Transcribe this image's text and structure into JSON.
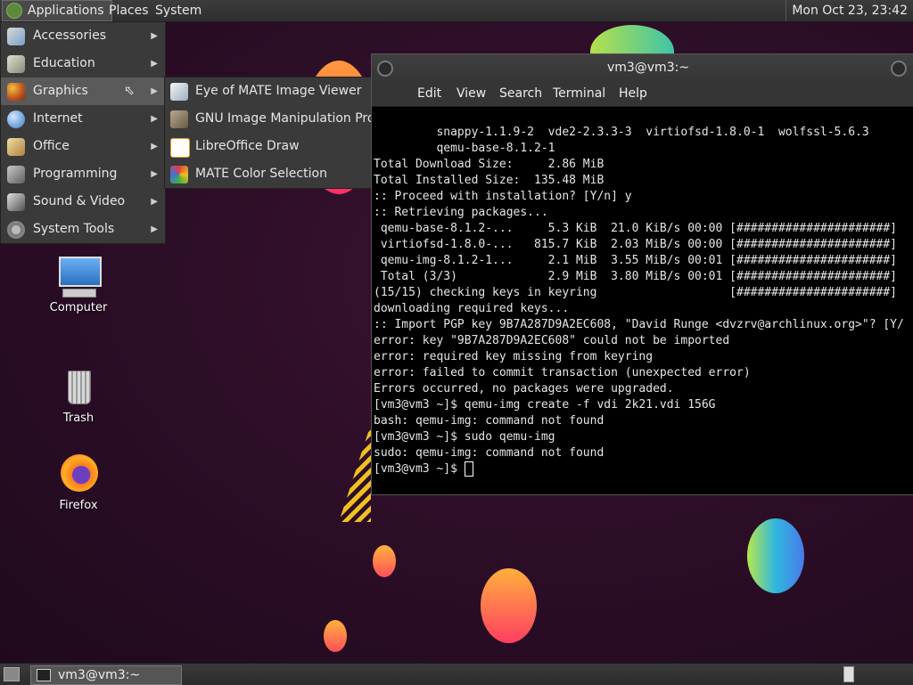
{
  "top_panel": {
    "applications_label": "Applications",
    "places_label": "Places",
    "system_label": "System",
    "clock": "Mon Oct 23, 23:42"
  },
  "app_menu": {
    "items": [
      {
        "label": "Accessories",
        "icon": "accessories-icon"
      },
      {
        "label": "Education",
        "icon": "education-icon"
      },
      {
        "label": "Graphics",
        "icon": "graphics-icon"
      },
      {
        "label": "Internet",
        "icon": "internet-icon"
      },
      {
        "label": "Office",
        "icon": "office-icon"
      },
      {
        "label": "Programming",
        "icon": "programming-icon"
      },
      {
        "label": "Sound & Video",
        "icon": "sound-video-icon"
      },
      {
        "label": "System Tools",
        "icon": "system-tools-icon"
      }
    ],
    "active_item": "Graphics"
  },
  "graphics_submenu": {
    "items": [
      {
        "label": "Eye of MATE Image Viewer",
        "icon": "image-viewer-icon"
      },
      {
        "label": "GNU Image Manipulation Program",
        "icon": "gimp-icon"
      },
      {
        "label": "LibreOffice Draw",
        "icon": "libreoffice-draw-icon"
      },
      {
        "label": "MATE Color Selection",
        "icon": "color-selection-icon"
      }
    ]
  },
  "desktop_icons": {
    "computer": "Computer",
    "trash": "Trash",
    "firefox": "Firefox"
  },
  "terminal": {
    "title": "vm3@vm3:~",
    "menu": [
      "Edit",
      "View",
      "Search",
      "Terminal",
      "Help"
    ],
    "lines": [
      "         snappy-1.1.9-2  vde2-2.3.3-3  virtiofsd-1.8.0-1  wolfssl-5.6.3",
      "         qemu-base-8.1.2-1",
      "",
      "Total Download Size:     2.86 MiB",
      "Total Installed Size:  135.48 MiB",
      "",
      ":: Proceed with installation? [Y/n] y",
      ":: Retrieving packages...",
      " qemu-base-8.1.2-...     5.3 KiB  21.0 KiB/s 00:00 [######################]",
      " virtiofsd-1.8.0-...   815.7 KiB  2.03 MiB/s 00:00 [######################]",
      " qemu-img-8.1.2-1...     2.1 MiB  3.55 MiB/s 00:01 [######################]",
      " Total (3/3)             2.9 MiB  3.80 MiB/s 00:01 [######################]",
      "(15/15) checking keys in keyring                   [######################]",
      "downloading required keys...",
      ":: Import PGP key 9B7A287D9A2EC608, \"David Runge <dvzrv@archlinux.org>\"? [Y/",
      "error: key \"9B7A287D9A2EC608\" could not be imported",
      "error: required key missing from keyring",
      "error: failed to commit transaction (unexpected error)",
      "Errors occurred, no packages were upgraded.",
      "[vm3@vm3 ~]$ qemu-img create -f vdi 2k21.vdi 156G",
      "bash: qemu-img: command not found",
      "[vm3@vm3 ~]$ sudo qemu-img",
      "sudo: qemu-img: command not found"
    ],
    "prompt": "[vm3@vm3 ~]$ "
  },
  "bottom_panel": {
    "task_label": "vm3@vm3:~"
  }
}
